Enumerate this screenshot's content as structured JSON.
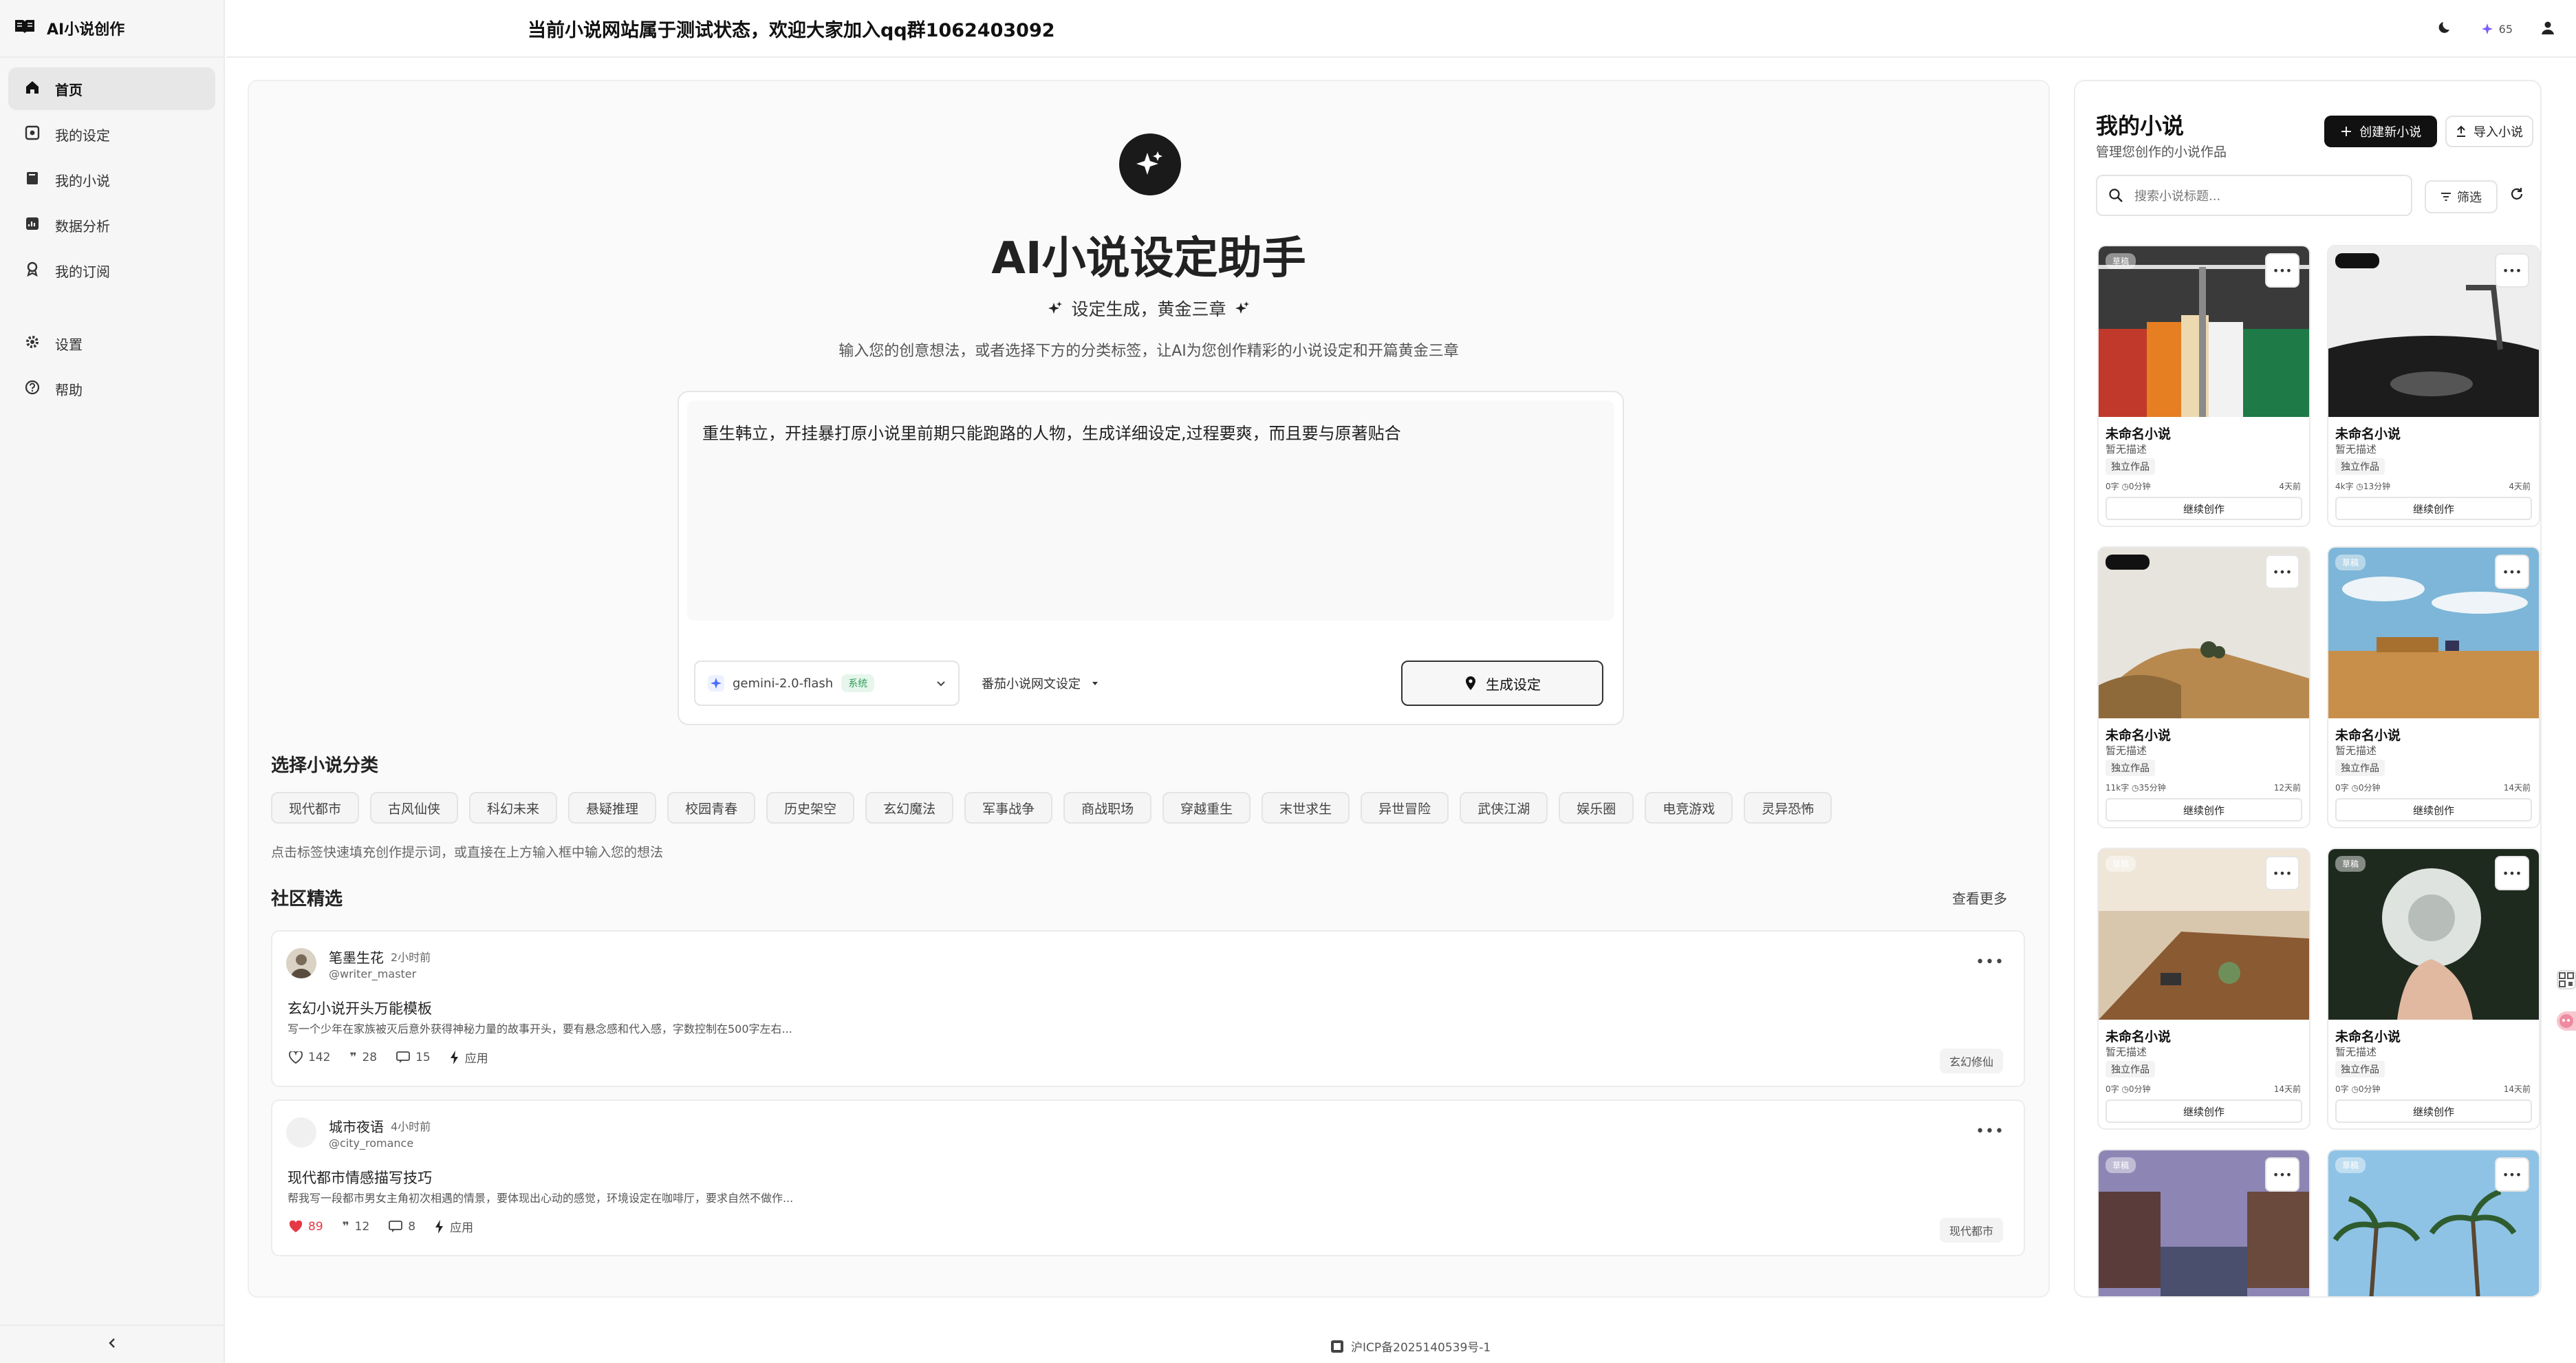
{
  "brand": {
    "title": "AI小说创作"
  },
  "sidebar": {
    "items": [
      {
        "label": "首页",
        "icon": "home-icon"
      },
      {
        "label": "我的设定",
        "icon": "settings-box-icon"
      },
      {
        "label": "我的小说",
        "icon": "book-icon"
      },
      {
        "label": "数据分析",
        "icon": "chart-icon"
      },
      {
        "label": "我的订阅",
        "icon": "badge-icon"
      }
    ],
    "secondary": [
      {
        "label": "设置",
        "icon": "gear-icon"
      },
      {
        "label": "帮助",
        "icon": "help-icon"
      }
    ]
  },
  "topbar": {
    "notice": "当前小说网站属于测试状态，欢迎大家加入qq群1062403092",
    "credits": "65"
  },
  "hero": {
    "title": "AI小说设定助手",
    "subtitle": "设定生成，黄金三章",
    "description": "输入您的创意想法，或者选择下方的分类标签，让AI为您创作精彩的小说设定和开篇黄金三章"
  },
  "prompt": {
    "text": "重生韩立，开挂暴打原小说里前期只能跑路的人物，生成详细设定,过程要爽，而且要与原著贴合",
    "model": "gemini-2.0-flash",
    "model_badge": "系统",
    "type": "番茄小说网文设定",
    "generate_label": "生成设定"
  },
  "categories": {
    "title": "选择小说分类",
    "tags": [
      "现代都市",
      "古风仙侠",
      "科幻未来",
      "悬疑推理",
      "校园青春",
      "历史架空",
      "玄幻魔法",
      "军事战争",
      "商战职场",
      "穿越重生",
      "末世求生",
      "异世冒险",
      "武侠江湖",
      "娱乐圈",
      "电竞游戏",
      "灵异恐怖"
    ],
    "hint": "点击标签快速填充创作提示词，或直接在上方输入框中输入您的想法"
  },
  "community": {
    "title": "社区精选",
    "see_more": "查看更多",
    "posts": [
      {
        "author": "笔墨生花",
        "time": "2小时前",
        "handle": "@writer_master",
        "title": "玄幻小说开头万能模板",
        "body": "写一个少年在家族被灭后意外获得神秘力量的故事开头，要有悬念感和代入感，字数控制在500字左右...",
        "likes": "142",
        "quotes": "28",
        "comments": "15",
        "apply": "应用",
        "tag": "玄幻修仙"
      },
      {
        "author": "城市夜语",
        "time": "4小时前",
        "handle": "@city_romance",
        "title": "现代都市情感描写技巧",
        "body": "帮我写一段都市男女主角初次相遇的情景，要体现出心动的感觉，环境设定在咖啡厅，要求自然不做作...",
        "likes": "89",
        "quotes": "12",
        "comments": "8",
        "apply": "应用",
        "tag": "现代都市"
      }
    ]
  },
  "footer": {
    "icp": "沪ICP备2025140539号-1"
  },
  "novels": {
    "title": "我的小说",
    "subtitle": "管理您创作的小说作品",
    "create_label": "创建新小说",
    "import_label": "导入小说",
    "search_placeholder": "搜索小说标题...",
    "filter_label": "筛选",
    "cards": [
      {
        "badge": "草稿",
        "badge_dark": false,
        "title": "未命名小说",
        "desc": "暂无描述",
        "type": "独立作品",
        "meta": "0字  ◷0分钟",
        "ago": "4天前",
        "action": "继续创作",
        "image": "hangers"
      },
      {
        "badge": "",
        "badge_dark": true,
        "title": "未命名小说",
        "desc": "暂无描述",
        "type": "独立作品",
        "meta": "4k字  ◷13分钟",
        "ago": "4天前",
        "action": "继续创作",
        "image": "turntable"
      },
      {
        "badge": "",
        "badge_dark": true,
        "title": "未命名小说",
        "desc": "暂无描述",
        "type": "独立作品",
        "meta": "11k字  ◷35分钟",
        "ago": "12天前",
        "action": "继续创作",
        "image": "hill"
      },
      {
        "badge": "草稿",
        "badge_dark": false,
        "title": "未命名小说",
        "desc": "暂无描述",
        "type": "独立作品",
        "meta": "0字  ◷0分钟",
        "ago": "14天前",
        "action": "继续创作",
        "image": "field"
      },
      {
        "badge": "草稿",
        "badge_dark": false,
        "title": "未命名小说",
        "desc": "暂无描述",
        "type": "独立作品",
        "meta": "0字  ◷0分钟",
        "ago": "14天前",
        "action": "继续创作",
        "image": "cafe"
      },
      {
        "badge": "草稿",
        "badge_dark": false,
        "title": "未命名小说",
        "desc": "暂无描述",
        "type": "独立作品",
        "meta": "0字  ◷0分钟",
        "ago": "14天前",
        "action": "继续创作",
        "image": "dandelion"
      },
      {
        "badge": "草稿",
        "badge_dark": false,
        "title": "",
        "desc": "",
        "type": "",
        "meta": "",
        "ago": "",
        "action": "",
        "image": "canal"
      },
      {
        "badge": "草稿",
        "badge_dark": false,
        "title": "",
        "desc": "",
        "type": "",
        "meta": "",
        "ago": "",
        "action": "",
        "image": "palms"
      }
    ]
  },
  "colors": {
    "accent": "#111111",
    "like_active": "#e53946",
    "badge_green": "#2f9e5b"
  }
}
